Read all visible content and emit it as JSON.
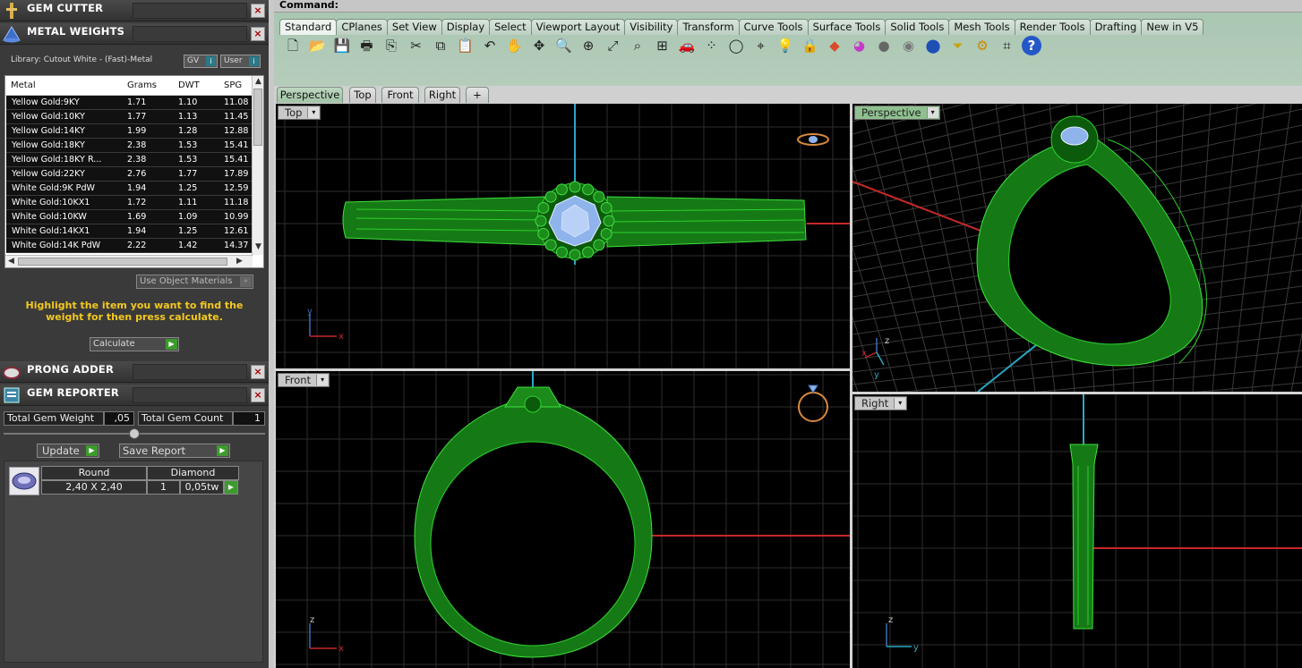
{
  "panels": {
    "gem_cutter": {
      "title": "GEM CUTTER",
      "close": "×"
    },
    "metal_weights": {
      "title": "METAL WEIGHTS",
      "close": "×",
      "library": "Library: Cutout White - (Fast)-Metal",
      "gv_label": "GV",
      "user_label": "User",
      "columns": [
        "Metal",
        "Grams",
        "DWT",
        "SPG"
      ],
      "rows": [
        {
          "metal": "Yellow Gold:9KY",
          "grams": "1.71",
          "dwt": "1.10",
          "spg": "11.08"
        },
        {
          "metal": "Yellow Gold:10KY",
          "grams": "1.77",
          "dwt": "1.13",
          "spg": "11.45"
        },
        {
          "metal": "Yellow Gold:14KY",
          "grams": "1.99",
          "dwt": "1.28",
          "spg": "12.88"
        },
        {
          "metal": "Yellow Gold:18KY",
          "grams": "2.38",
          "dwt": "1.53",
          "spg": "15.41"
        },
        {
          "metal": "Yellow Gold:18KY R...",
          "grams": "2.38",
          "dwt": "1.53",
          "spg": "15.41"
        },
        {
          "metal": "Yellow Gold:22KY",
          "grams": "2.76",
          "dwt": "1.77",
          "spg": "17.89"
        },
        {
          "metal": "White Gold:9K PdW",
          "grams": "1.94",
          "dwt": "1.25",
          "spg": "12.59"
        },
        {
          "metal": "White Gold:10KX1",
          "grams": "1.72",
          "dwt": "1.11",
          "spg": "11.18"
        },
        {
          "metal": "White Gold:10KW",
          "grams": "1.69",
          "dwt": "1.09",
          "spg": "10.99"
        },
        {
          "metal": "White Gold:14KX1",
          "grams": "1.94",
          "dwt": "1.25",
          "spg": "12.61"
        },
        {
          "metal": "White Gold:14K PdW",
          "grams": "2.22",
          "dwt": "1.42",
          "spg": "14.37"
        }
      ],
      "use_object_materials": "Use Object Materials",
      "hint": "Highlight the item you want to find the weight for then press calculate.",
      "calculate": "Calculate"
    },
    "prong_adder": {
      "title": "PRONG ADDER",
      "close": "×"
    },
    "gem_reporter": {
      "title": "GEM REPORTER",
      "close": "×",
      "total_weight_label": "Total Gem Weight",
      "total_weight_value": ",05",
      "total_count_label": "Total Gem Count",
      "total_count_value": "1",
      "update": "Update",
      "save_report": "Save Report",
      "gem": {
        "shape": "Round",
        "size": "2,40 X 2,40",
        "type": "Diamond",
        "qty": "1",
        "weight": "0,05tw"
      }
    }
  },
  "command": {
    "label": "Command:"
  },
  "toolbar_tabs": [
    "Standard",
    "CPlanes",
    "Set View",
    "Display",
    "Select",
    "Viewport Layout",
    "Visibility",
    "Transform",
    "Curve Tools",
    "Surface Tools",
    "Solid Tools",
    "Mesh Tools",
    "Render Tools",
    "Drafting",
    "New in V5"
  ],
  "toolbar_icons": [
    "new-file-icon",
    "open-folder-icon",
    "save-icon",
    "print-icon",
    "import-icon",
    "cut-icon",
    "copy-icon",
    "paste-icon",
    "undo-icon",
    "pan-hand-icon",
    "rotate-view-icon",
    "zoom-icon",
    "zoom-window-icon",
    "zoom-extents-icon",
    "zoom-selected-icon",
    "four-view-icon",
    "car-icon",
    "dots-icon",
    "circle-icon",
    "snap-icon",
    "lightbulb-icon",
    "lock-icon",
    "layers-icon",
    "color-wheel-icon",
    "render-sphere-icon",
    "material-sphere-icon",
    "blue-sphere-icon",
    "select-filter-icon",
    "settings-gear-icon",
    "dimension-icon",
    "help-icon"
  ],
  "viewport_tabs": [
    "Perspective",
    "Top",
    "Front",
    "Right",
    "+"
  ],
  "viewports": {
    "top": "Top",
    "perspective": "Perspective",
    "front": "Front",
    "right": "Right"
  },
  "axis_labels": {
    "x": "x",
    "y": "y",
    "z": "z"
  }
}
